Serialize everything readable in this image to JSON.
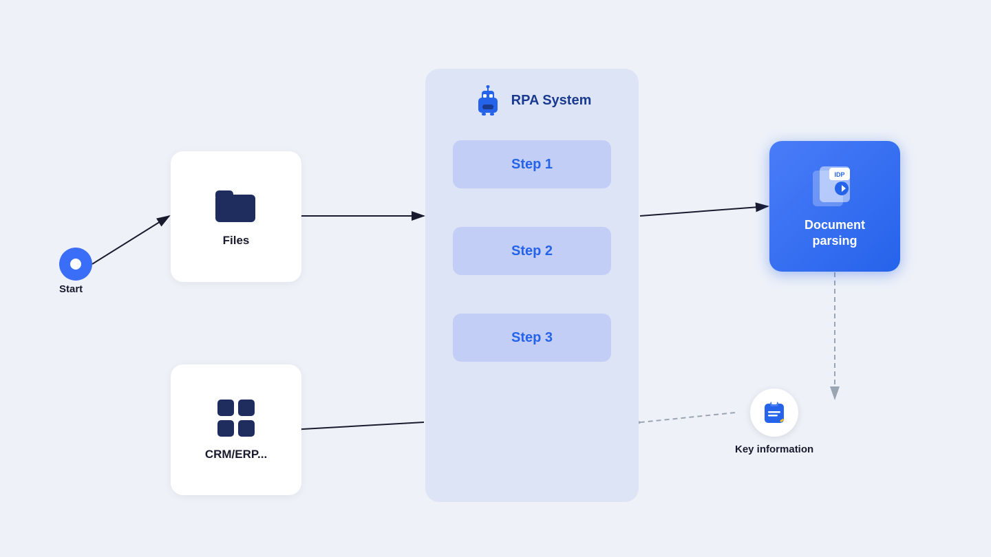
{
  "nodes": {
    "start": {
      "label": "Start"
    },
    "files": {
      "label": "Files"
    },
    "crm": {
      "label": "CRM/ERP..."
    },
    "rpa": {
      "title": "RPA System",
      "steps": [
        {
          "label": "Step 1"
        },
        {
          "label": "Step 2"
        },
        {
          "label": "Step 3"
        }
      ]
    },
    "docParsing": {
      "label": "Document\nparsing",
      "badge": "IDP"
    },
    "keyInfo": {
      "label": "Key information"
    }
  },
  "colors": {
    "blue": "#2563eb",
    "lightBlue": "#4a7cf8",
    "darkBlue": "#1a3a8f",
    "darkNavy": "#1e2d5e",
    "rpaBackground": "#dde4f5",
    "stepBackground": "#c2cef5",
    "pageBackground": "#eef1f8",
    "white": "#ffffff",
    "arrowColor": "#1a1a2e"
  }
}
